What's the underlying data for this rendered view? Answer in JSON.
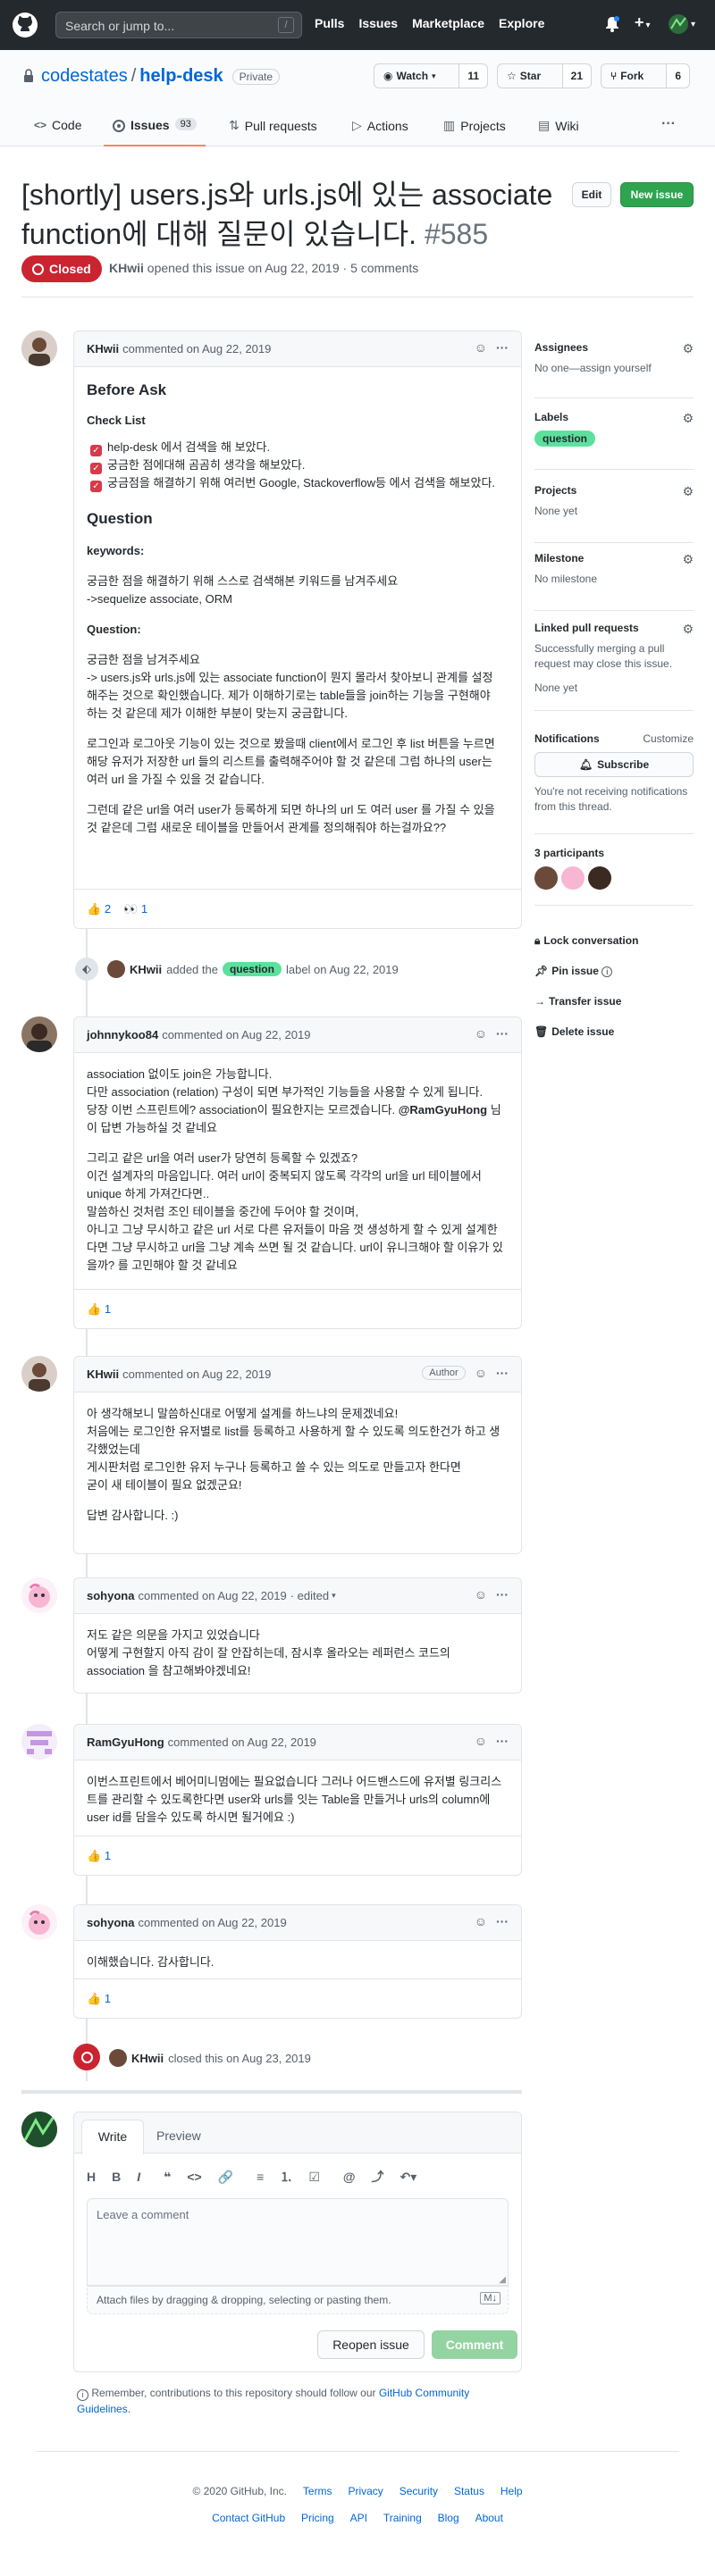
{
  "header": {
    "search_placeholder": "Search or jump to...",
    "slash": "/",
    "nav": [
      "Pulls",
      "Issues",
      "Marketplace",
      "Explore"
    ],
    "plus": "+",
    "caret": "▾"
  },
  "repo": {
    "owner": "codestates",
    "sep": "/",
    "name": "help-desk",
    "visibility": "Private",
    "watch_label": "Watch",
    "watch_count": "11",
    "star_label": "Star",
    "star_count": "21",
    "fork_label": "Fork",
    "fork_count": "6"
  },
  "tabs": [
    {
      "label": "Code",
      "icon": "code-icon"
    },
    {
      "label": "Issues",
      "count": "93",
      "icon": "issue-icon"
    },
    {
      "label": "Pull requests",
      "icon": "pr-icon"
    },
    {
      "label": "Actions",
      "icon": "play-icon"
    },
    {
      "label": "Projects",
      "icon": "project-icon"
    },
    {
      "label": "Wiki",
      "icon": "book-icon"
    },
    {
      "label": "···"
    }
  ],
  "issue": {
    "title_line1": "[shortly] users.js와 urls.js에 있는 associate",
    "title_line2": "function에 대해 질문이 있습니다.",
    "number": "#585",
    "edit": "Edit",
    "new_issue": "New issue",
    "state": "Closed",
    "author": "KHwii",
    "meta": "opened this issue on Aug 22, 2019 · 5 comments"
  },
  "first_comment": {
    "author": "KHwii",
    "action": "commented on Aug 22, 2019",
    "h_before": "Before Ask",
    "h_checklist": "Check List",
    "checks": [
      "help-desk 에서 검색을 해 보았다.",
      "궁금한 점에대해 곰곰히 생각을 해보았다.",
      "궁금점을 해결하기 위해 여러번 Google, Stackoverflow등 에서 검색을 해보았다."
    ],
    "h_question": "Question",
    "h_keywords": "keywords:",
    "keywords_1": "궁금한 점을 해결하기 위해 스스로 검색해본 키워드를 남겨주세요",
    "keywords_2": "->sequelize associate, ORM",
    "h_q": "Question:",
    "q_1": "궁금한 점을 남겨주세요",
    "q_2": "-> users.js와 urls.js에 있는 associate function이 뭔지 몰라서 찾아보니 관계를 설정",
    "q_3": "해주는 것으로 확인했습니다. 제가 이해하기로는 table들을 join하는 기능을 구현해야",
    "q_4": "하는 것 같은데 제가 이해한 부분이 맞는지 궁금합니다.",
    "p2_1": "로그인과 로그아웃 기능이 있는 것으로 봤을때 client에서 로그인 후 list 버튼을 누르면",
    "p2_2": "해당 유저가 저장한 url 들의 리스트를 출력해주어야 할 것 같은데 그럼 하나의 user는",
    "p2_3": "여러 url 을 가질 수 있을 것 같습니다.",
    "p3_1": "그런데 같은 url을 여러 user가 등록하게 되면 하나의 url 도 여러 user 를 가질 수 있을",
    "p3_2": "것 같은데 그럼 새로운 테이블을 만들어서 관계를 정의해줘야 하는걸까요??",
    "react_thumbs": "👍",
    "react_thumbs_count": "2",
    "react_eyes": "👀",
    "react_eyes_count": "1"
  },
  "label_event": {
    "actor": "KHwii",
    "text1": "added the",
    "label": "question",
    "text2": "label on Aug 22, 2019"
  },
  "comments": [
    {
      "author": "johnnykoo84",
      "action": "commented on Aug 22, 2019",
      "lines_a": [
        "association 없이도 join은 가능합니다.",
        "다만 association (relation) 구성이 되면 부가적인 기능들을 사용할 수 있게 됩니다.",
        "당장 이번 스프린트에? association이 필요한지는 모르겠습니다."
      ],
      "mention": "@RamGyuHong",
      "mention_tail": " 님",
      "line_a4": "이 답변 가능하실 것 같네요",
      "lines_b": [
        "그리고 같은 url을 여러 user가 당연히 등록할 수 있겠죠?",
        "이건 설계자의 마음입니다. 여러 url이 중복되지 않도록 각각의 url을 url 테이블에서",
        "unique 하게 가져간다면..",
        "말씀하신 것처럼 조인 테이블을 중간에 두어야 할 것이며,",
        "아니고 그냥 무시하고 같은 url 서로 다른 유저들이 마음 껏 생성하게 할 수 있게 설계한",
        "다면 그냥 무시하고 url을 그냥 계속 쓰면 될 것 같습니다. url이 유니크해야 할 이유가 있",
        "을까? 를 고민해야 할 것 같네요"
      ],
      "react": "👍",
      "react_count": "1"
    },
    {
      "author": "KHwii",
      "action": "commented on Aug 22, 2019",
      "badge": "Author",
      "lines_a": [
        "아 생각해보니 말씀하신대로 어떻게 설계를 하느냐의 문제겠네요!",
        "처음에는 로그인한 유저별로 list를 등록하고 사용하게 할 수 있도록 의도한건가 하고 생",
        "각했었는데",
        "게시판처럼 로그인한 유저 누구나 등록하고 쓸 수 있는 의도로 만들고자 한다면",
        "굳이 새 테이블이 필요 없겠군요!"
      ],
      "line_b": "답변 감사합니다. :)"
    },
    {
      "author": "sohyona",
      "action": "commented on Aug 22, 2019",
      "edited": "· edited",
      "lines_a": [
        "저도 같은 의문을 가지고 있었습니다",
        "어떻게 구현할지 아직 감이 잘 안잡히는데, 잠시후 올라오는 레퍼런스 코드의",
        "association 을 참고해봐야겠네요!"
      ]
    },
    {
      "author": "RamGyuHong",
      "action": "commented on Aug 22, 2019",
      "lines_a": [
        "이번스프린트에서 베어미니멈에는 필요없습니다 그러나 어드밴스드에 유저별 링크리스",
        "트를 관리할 수 있도록한다면 user와 urls를 잇는 Table을 만들거나 urls의 column에",
        "user id를 담을수 있도록 하시면 될거에요 :)"
      ],
      "react": "👍",
      "react_count": "1"
    },
    {
      "author": "sohyona",
      "action": "commented on Aug 22, 2019",
      "lines_a": [
        "이해했습니다. 감사합니다."
      ],
      "react": "👍",
      "react_count": "1"
    }
  ],
  "close_event": {
    "actor": "KHwii",
    "text": "closed this on Aug 23, 2019"
  },
  "editor": {
    "tab_write": "Write",
    "tab_preview": "Preview",
    "placeholder": "Leave a comment",
    "attach": "Attach files by dragging & dropping, selecting or pasting them.",
    "md": "M↓",
    "reopen": "Reopen issue",
    "comment": "Comment",
    "tip": "Remember, contributions to this repository should follow our",
    "tip_link_1": "GitHub Community",
    "tip_link_2": "Guidelines",
    "tip_end": "."
  },
  "sidebar": {
    "assignees_title": "Assignees",
    "assignees_value": "No one—assign yourself",
    "labels_title": "Labels",
    "label": "question",
    "projects_title": "Projects",
    "projects_value": "None yet",
    "milestone_title": "Milestone",
    "milestone_value": "No milestone",
    "linked_title": "Linked pull requests",
    "linked_text_1": "Successfully merging a pull",
    "linked_text_2": "request may close this issue.",
    "linked_value": "None yet",
    "notif_title": "Notifications",
    "customize": "Customize",
    "subscribe": "Subscribe",
    "notif_text_1": "You're not receiving notifications",
    "notif_text_2": "from this thread.",
    "participants": "3 participants",
    "lock": "Lock conversation",
    "pin": "Pin issue",
    "transfer": "Transfer issue",
    "delete": "Delete issue"
  },
  "footer": {
    "copyright": "© 2020 GitHub, Inc.",
    "row1": [
      "Terms",
      "Privacy",
      "Security",
      "Status",
      "Help"
    ],
    "row2": [
      "Contact GitHub",
      "Pricing",
      "API",
      "Training",
      "Blog",
      "About"
    ]
  },
  "colors": {
    "header_bg": "#24292e",
    "closed_red": "#cb2431",
    "label_green": "#5ce19d",
    "primary_green": "#2ea44f",
    "link_blue": "#0366d6"
  }
}
